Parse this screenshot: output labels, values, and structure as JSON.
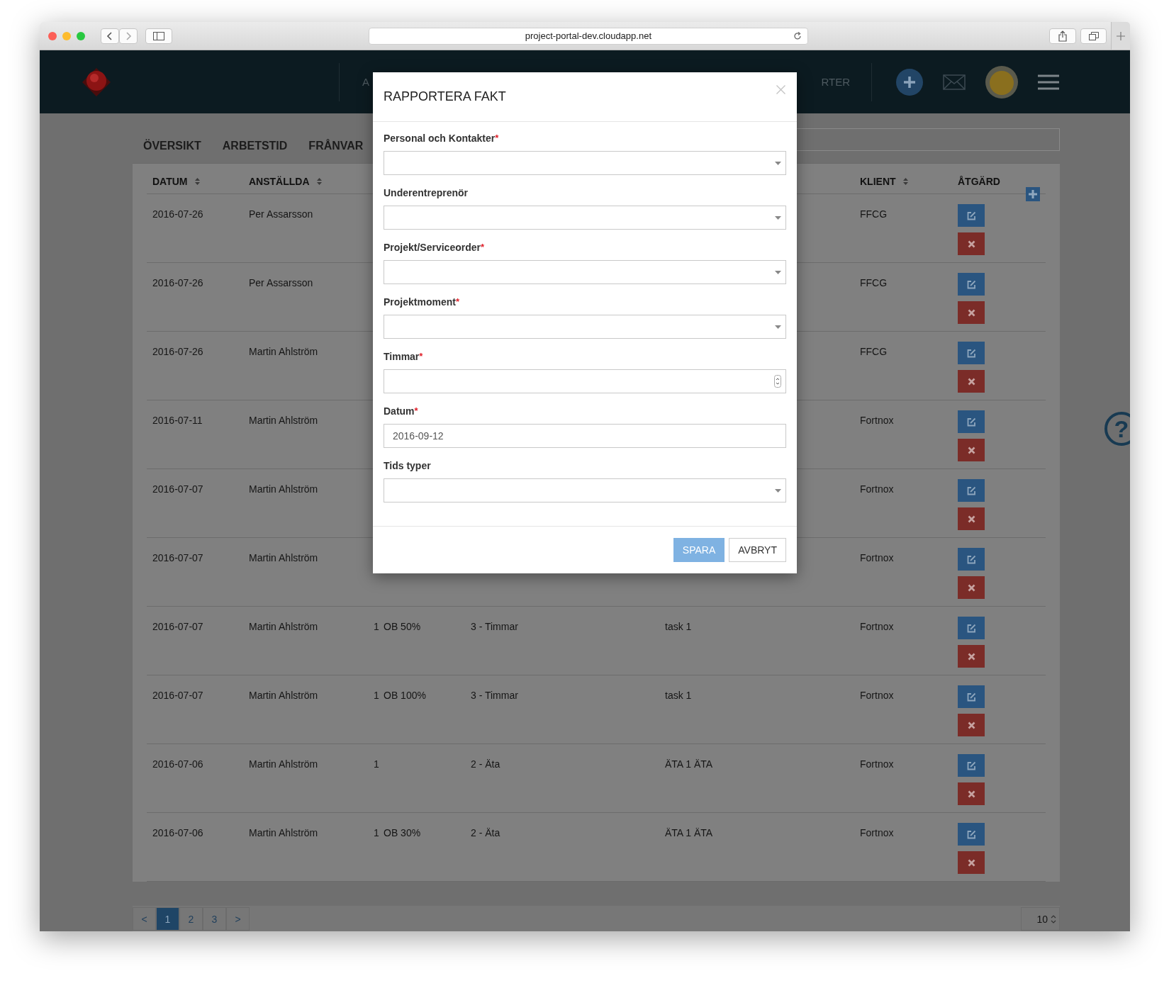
{
  "browser": {
    "url": "project-portal-dev.cloudapp.net"
  },
  "nav": {
    "items": [
      "A",
      "RTER"
    ]
  },
  "tabs": [
    {
      "label": "ÖVERSIKT"
    },
    {
      "label": "ARBETSTID"
    },
    {
      "label": "FRÅNVAR"
    }
  ],
  "table": {
    "columns": [
      {
        "label": "DATUM",
        "sortable": true
      },
      {
        "label": "ANSTÄLLDA",
        "sortable": true
      },
      {
        "label": "KLIENT",
        "sortable": true
      },
      {
        "label": "ÅTGÄRD",
        "sortable": false
      }
    ],
    "rows": [
      {
        "date": "2016-07-26",
        "employee": "Per Assarsson",
        "client": "FFCG"
      },
      {
        "date": "2016-07-26",
        "employee": "Per Assarsson",
        "client": "FFCG"
      },
      {
        "date": "2016-07-26",
        "employee": "Martin Ahlström",
        "client": "FFCG"
      },
      {
        "date": "2016-07-11",
        "employee": "Martin Ahlström",
        "client": "Fortnox"
      },
      {
        "date": "2016-07-07",
        "employee": "Martin Ahlström",
        "client": "Fortnox"
      },
      {
        "date": "2016-07-07",
        "employee": "Martin Ahlström",
        "client": "Fortnox"
      },
      {
        "date": "2016-07-07",
        "employee": "Martin Ahlström",
        "column_3": "1",
        "column_4": "OB 50%",
        "column_5": "3 - Timmar",
        "column_6": "task 1",
        "client": "Fortnox"
      },
      {
        "date": "2016-07-07",
        "employee": "Martin Ahlström",
        "column_3": "1",
        "column_4": "OB 100%",
        "column_5": "3 - Timmar",
        "column_6": "task 1",
        "client": "Fortnox"
      },
      {
        "date": "2016-07-06",
        "employee": "Martin Ahlström",
        "column_3": "1",
        "column_5": "2 - Äta",
        "column_6": "ÄTA 1 ÄTA",
        "client": "Fortnox"
      },
      {
        "date": "2016-07-06",
        "employee": "Martin Ahlström",
        "column_3": "1",
        "column_4": "OB 30%",
        "column_5": "2 - Äta",
        "column_6": "ÄTA 1 ÄTA",
        "client": "Fortnox"
      }
    ]
  },
  "pagination": {
    "prev": "<",
    "pages": [
      {
        "label": "1",
        "selected": true
      },
      {
        "label": "2",
        "selected": false
      },
      {
        "label": "3",
        "selected": false
      }
    ],
    "next": ">",
    "page_size": "10"
  },
  "help": "?",
  "modal": {
    "title": "RAPPORTERA FAKT",
    "fields": [
      {
        "label": "Personal och Kontakter",
        "required_mark": "*",
        "kind": "select"
      },
      {
        "label": "Underentreprenör",
        "kind": "select"
      },
      {
        "label": "Projekt/Serviceorder",
        "required_mark": "*",
        "kind": "select"
      },
      {
        "label": "Projektmoment",
        "required_mark": "*",
        "kind": "select"
      },
      {
        "label": "Timmar",
        "required_mark": "*",
        "kind": "number"
      },
      {
        "label": "Datum",
        "required_mark": "*",
        "kind": "date",
        "value": "2016-09-12"
      },
      {
        "label": "Tids typer",
        "kind": "select"
      }
    ],
    "buttons": [
      {
        "label": "SPARA",
        "kind": "primary"
      },
      {
        "label": "AVBRYT",
        "kind": "default"
      }
    ]
  }
}
